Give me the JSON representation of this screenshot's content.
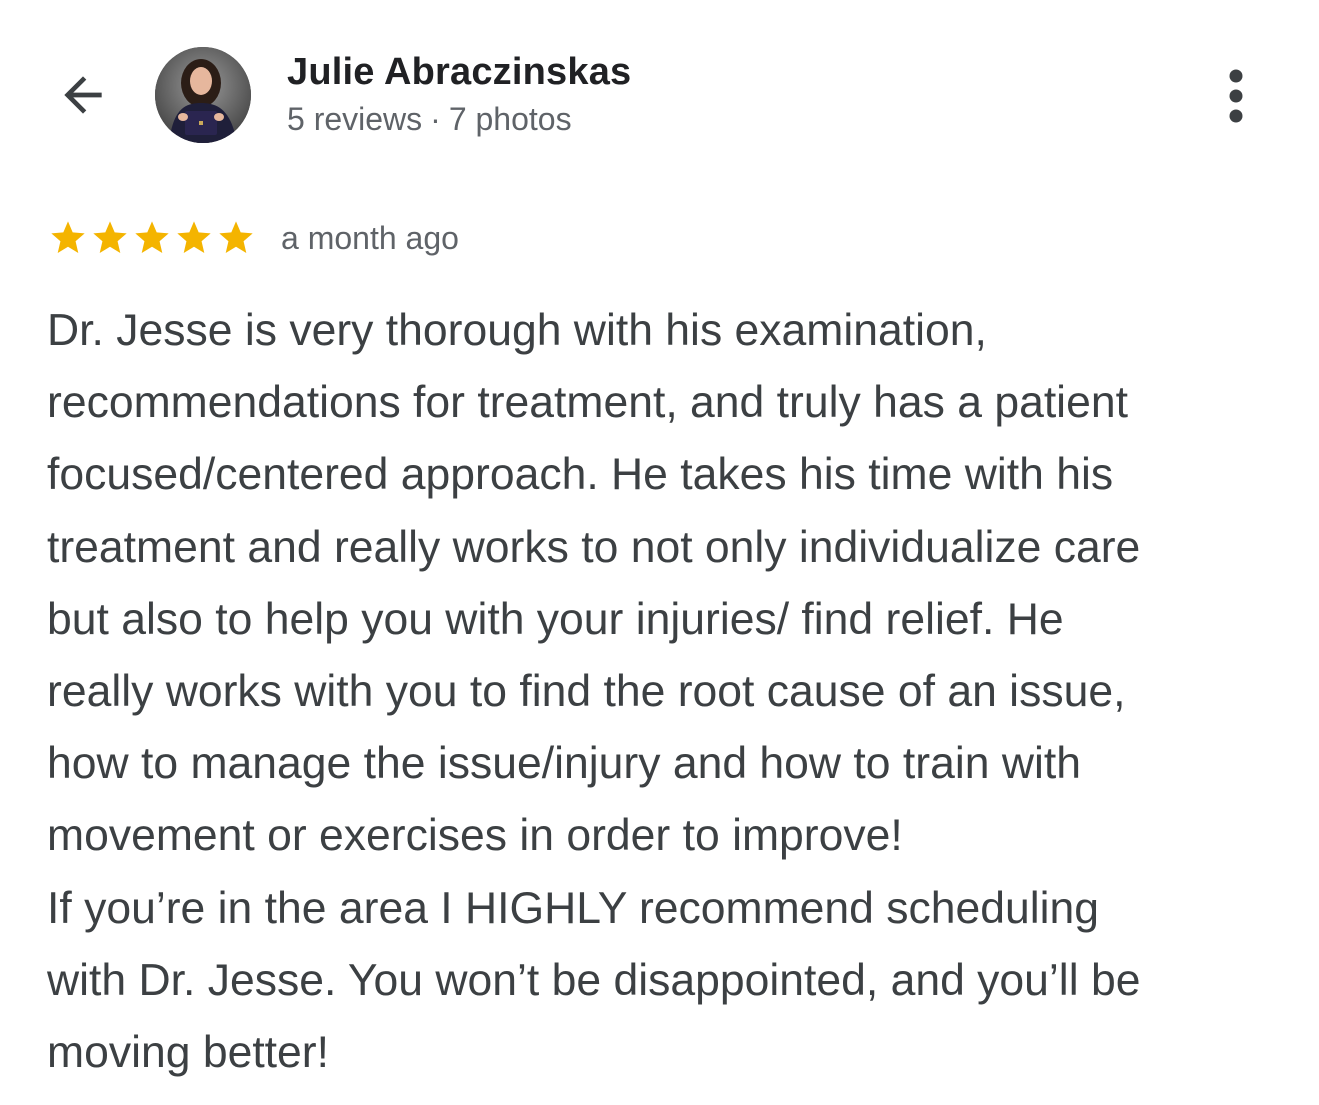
{
  "reviewer": {
    "name": "Julie Abraczinskas",
    "reviews_count": "5 reviews",
    "separator": "·",
    "photos_count": "7 photos",
    "avatar_icon": "profile-photo"
  },
  "review": {
    "rating": 5,
    "rating_max": 5,
    "star_color": "#f4b400",
    "time": "a month ago",
    "text": "Dr. Jesse is very thorough with his examination,\nrecommendations for treatment, and truly has a patient\nfocused/centered approach. He takes his time with his\ntreatment and really works to not only individualize care\nbut also to help you with your injuries/ find relief. He\nreally works with you to find the root cause of an issue,\nhow to manage the issue/injury and how to train with\nmovement or exercises in order to improve!\nIf you’re in the area I HIGHLY recommend scheduling\nwith Dr. Jesse. You won’t be disappointed, and you’ll be\nmoving better!"
  },
  "icons": {
    "back": "arrow-back-icon",
    "more": "more-vert-icon",
    "star": "star-icon"
  }
}
